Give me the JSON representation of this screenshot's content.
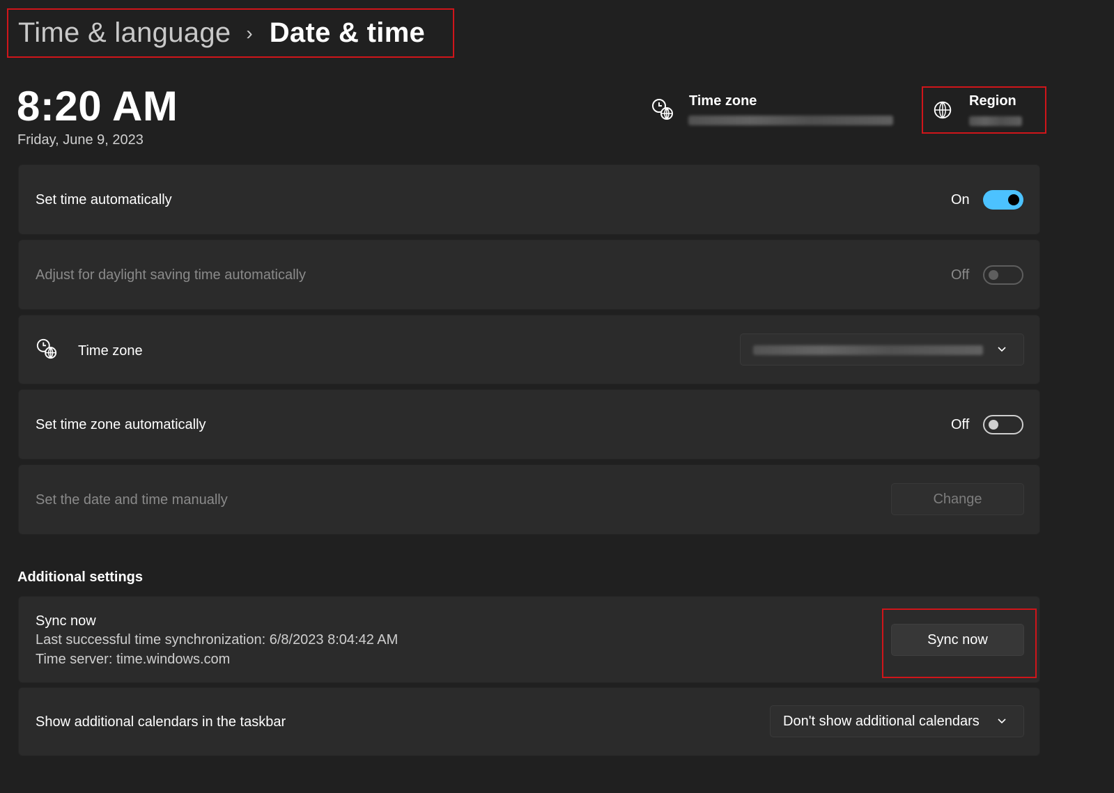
{
  "breadcrumb": {
    "parent": "Time & language",
    "separator": "›",
    "current": "Date & time"
  },
  "clock": {
    "time": "8:20 AM",
    "date": "Friday, June 9, 2023"
  },
  "header": {
    "timezone_label": "Time zone",
    "region_label": "Region"
  },
  "settings": {
    "set_time_auto": {
      "label": "Set time automatically",
      "state": "On"
    },
    "daylight": {
      "label": "Adjust for daylight saving time automatically",
      "state": "Off"
    },
    "timezone": {
      "label": "Time zone"
    },
    "set_tz_auto": {
      "label": "Set time zone automatically",
      "state": "Off"
    },
    "manual": {
      "label": "Set the date and time manually",
      "button": "Change"
    }
  },
  "additional": {
    "title": "Additional settings",
    "sync": {
      "label": "Sync now",
      "last_sync": "Last successful time synchronization: 6/8/2023 8:04:42 AM",
      "server": "Time server: time.windows.com",
      "button": "Sync now"
    },
    "calendars": {
      "label": "Show additional calendars in the taskbar",
      "selected": "Don't show additional calendars"
    }
  },
  "colors": {
    "accent": "#4cc2ff",
    "annotation": "#d0151a",
    "background": "#202020",
    "card": "#2b2b2b"
  },
  "icons": [
    "clock-globe-icon",
    "globe-icon",
    "chevron-down-icon"
  ]
}
